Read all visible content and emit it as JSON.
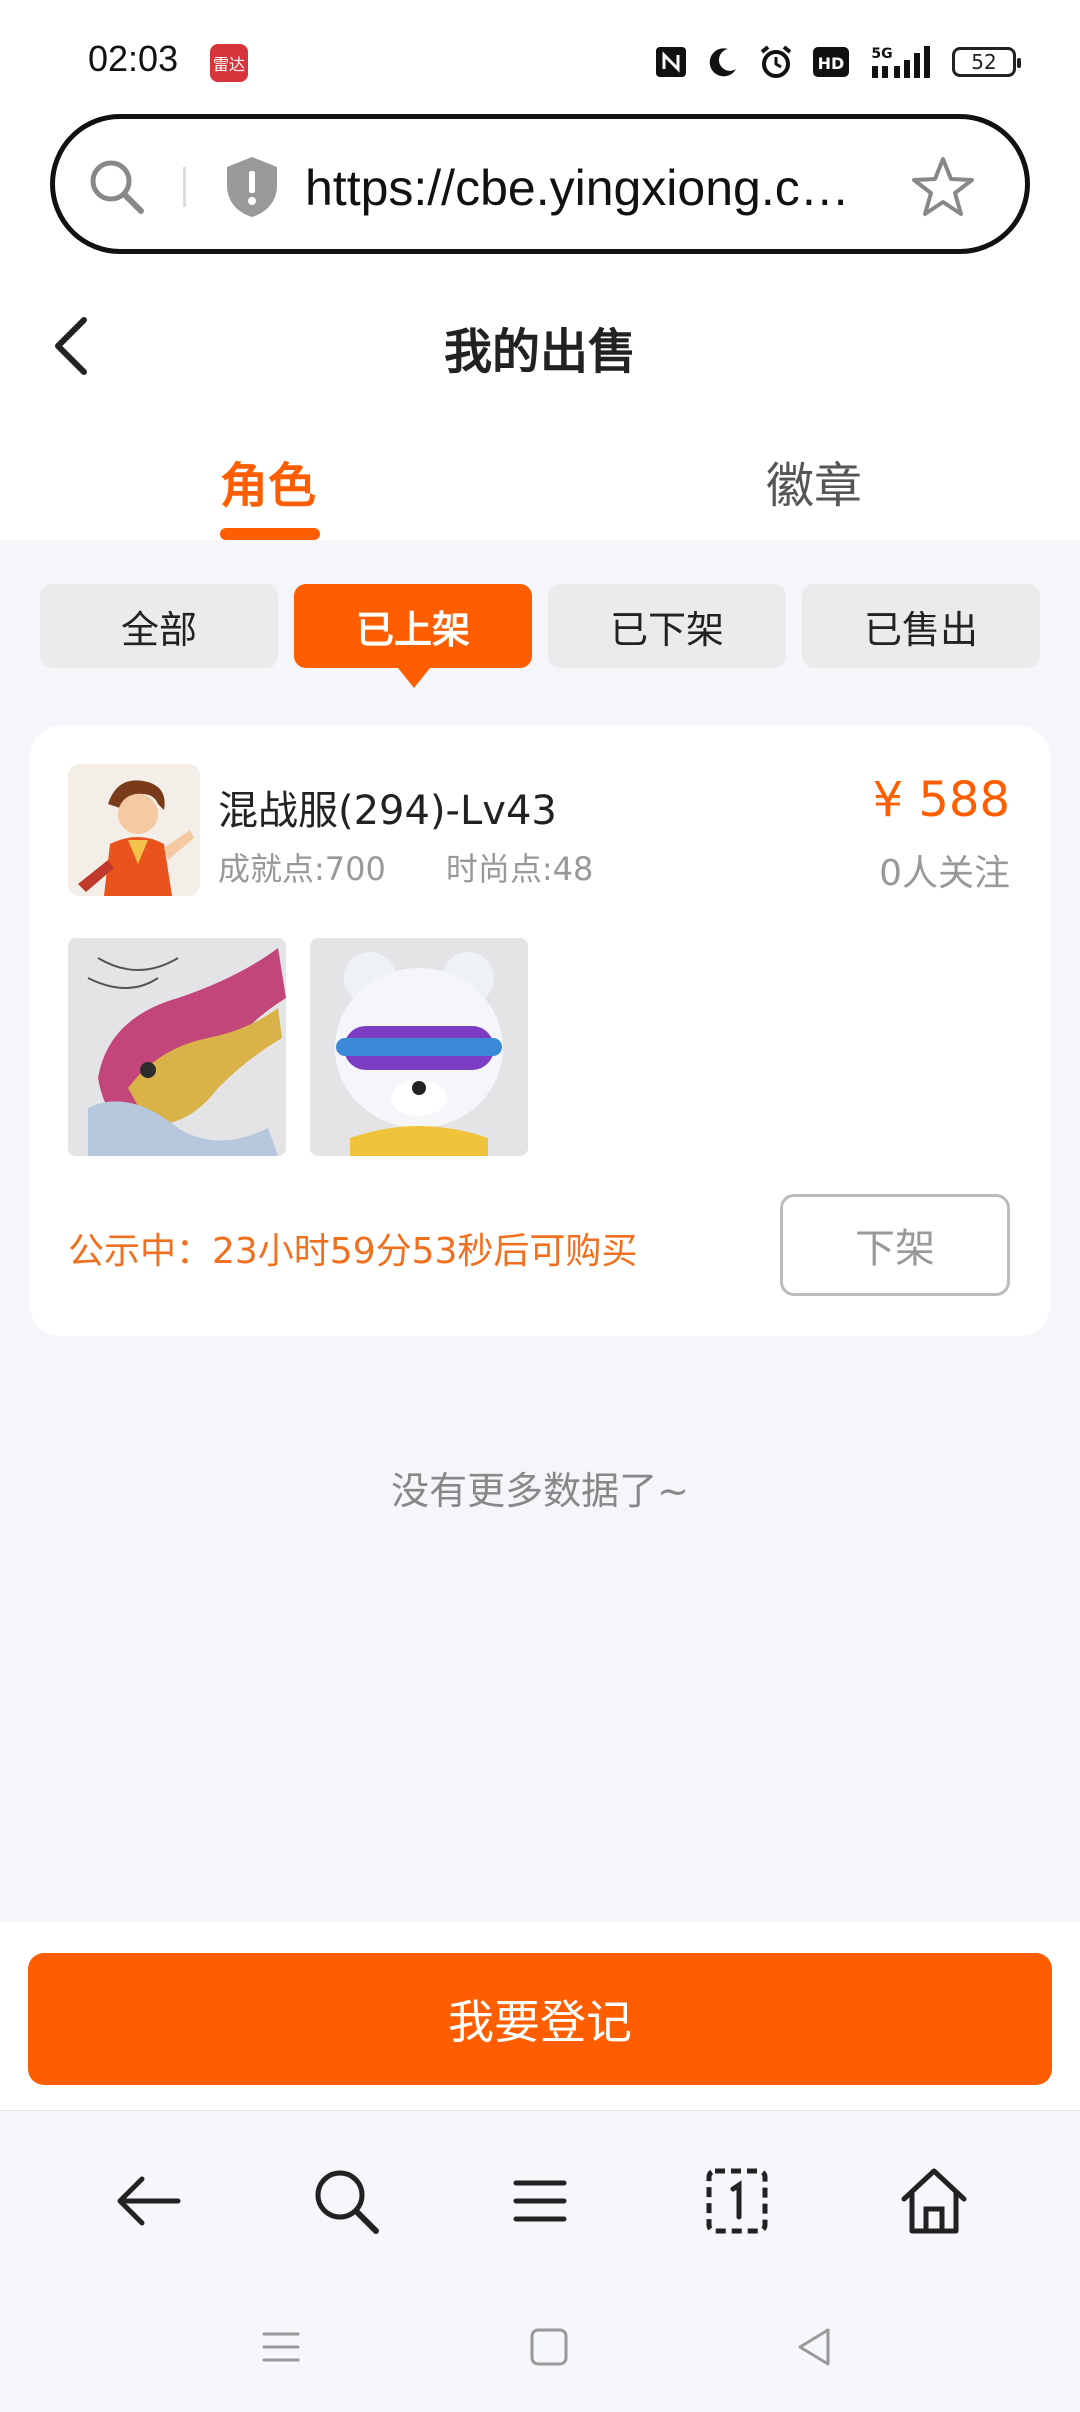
{
  "status_bar": {
    "time": "02:03",
    "app_icon_text": "雷达",
    "network": "5G",
    "battery": "52",
    "icons": [
      "nfc-icon",
      "moon-icon",
      "alarm-icon",
      "hd-icon",
      "signal-5g-icon",
      "battery-icon"
    ]
  },
  "browser": {
    "url": "https://cbe.yingxiong.co..."
  },
  "header": {
    "title": "我的出售"
  },
  "main_tabs": [
    {
      "label": "角色",
      "active": true
    },
    {
      "label": "徽章",
      "active": false
    }
  ],
  "filters": [
    {
      "label": "全部",
      "active": false
    },
    {
      "label": "已上架",
      "active": true
    },
    {
      "label": "已下架",
      "active": false
    },
    {
      "label": "已售出",
      "active": false
    }
  ],
  "listing": {
    "server_name": "混战服(294)-Lv43",
    "achievement": "成就点:700",
    "fashion": "时尚点:48",
    "price": "¥ 588",
    "followers": "0人关注",
    "notice": "公示中：23小时59分53秒后可购买",
    "delist_label": "下架"
  },
  "no_more": "没有更多数据了~",
  "register_button": "我要登记",
  "colors": {
    "accent": "#ff5e00",
    "background": "#f5f6fa",
    "card": "#ffffff",
    "muted_text": "#999999"
  }
}
